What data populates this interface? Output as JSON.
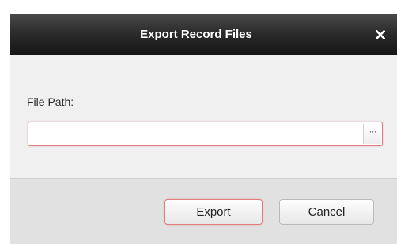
{
  "dialog": {
    "title": "Export Record Files",
    "close_icon": "close-icon"
  },
  "form": {
    "file_path_label": "File Path:",
    "file_path_value": "",
    "browse_label": "···"
  },
  "buttons": {
    "export_label": "Export",
    "cancel_label": "Cancel"
  },
  "colors": {
    "title_bar": "#1f1f1f",
    "title_text": "#ffffff",
    "content_background": "#f0f0f0",
    "footer_background": "#e1e1e1",
    "focus_border": "#e07c80"
  }
}
